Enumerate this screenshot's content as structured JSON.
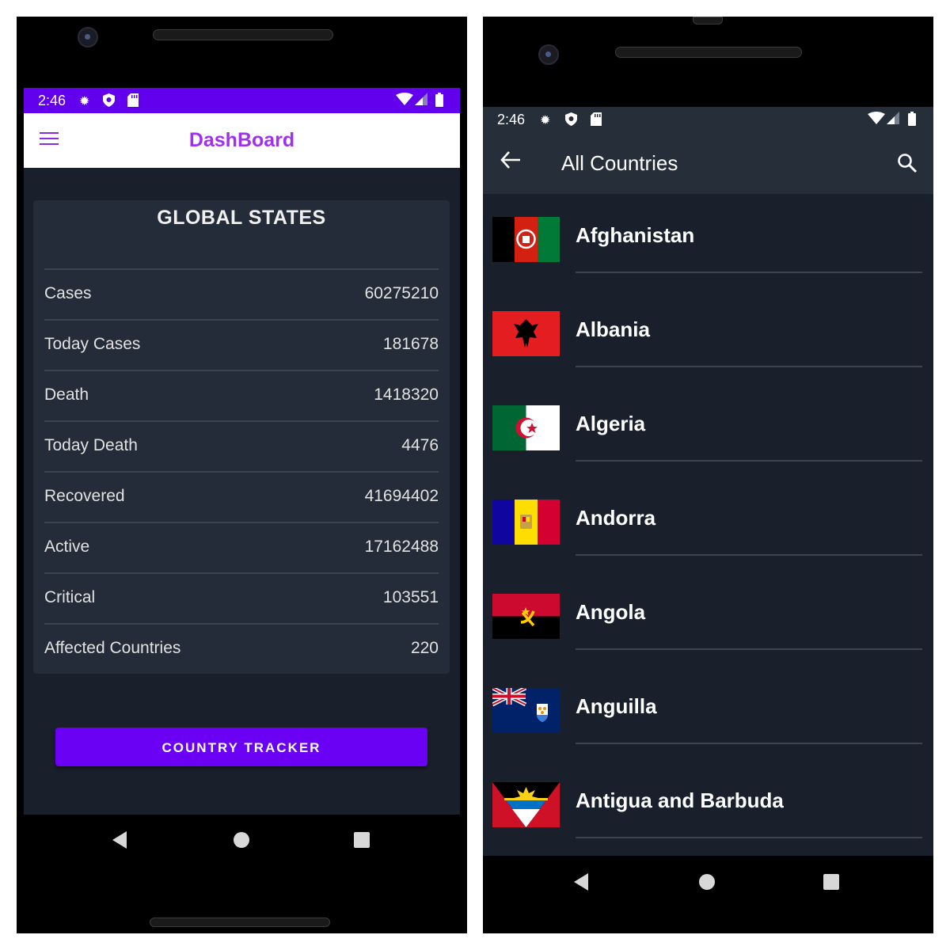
{
  "dashboard": {
    "status_time": "2:46",
    "title": "DashBoard",
    "card_title": "GLOBAL STATES",
    "stats": [
      {
        "label": "Cases",
        "value": "60275210"
      },
      {
        "label": "Today Cases",
        "value": "181678"
      },
      {
        "label": "Death",
        "value": "1418320"
      },
      {
        "label": "Today Death",
        "value": "4476"
      },
      {
        "label": "Recovered",
        "value": "41694402"
      },
      {
        "label": "Active",
        "value": "17162488"
      },
      {
        "label": "Critical",
        "value": "103551"
      },
      {
        "label": "Affected Countries",
        "value": "220"
      }
    ],
    "button_label": "COUNTRY TRACKER"
  },
  "countries_screen": {
    "status_time": "2:46",
    "title": "All Countries",
    "countries": [
      {
        "name": "Afghanistan"
      },
      {
        "name": "Albania"
      },
      {
        "name": "Algeria"
      },
      {
        "name": "Andorra"
      },
      {
        "name": "Angola"
      },
      {
        "name": "Anguilla"
      },
      {
        "name": "Antigua and Barbuda"
      }
    ]
  },
  "icons": {
    "menu": "hamburger-menu-icon",
    "back": "arrow-back-icon",
    "search": "search-icon",
    "settings": "gear-icon",
    "shield": "shield-icon",
    "sd": "sd-card-icon",
    "wifi": "wifi-icon",
    "signal": "signal-icon",
    "battery": "battery-icon"
  },
  "colors": {
    "primary": "#6200ee",
    "title_purple": "#a02ff0",
    "background": "#1a1f2c",
    "card": "#232c38",
    "toolbar_dark": "#262e3a"
  }
}
